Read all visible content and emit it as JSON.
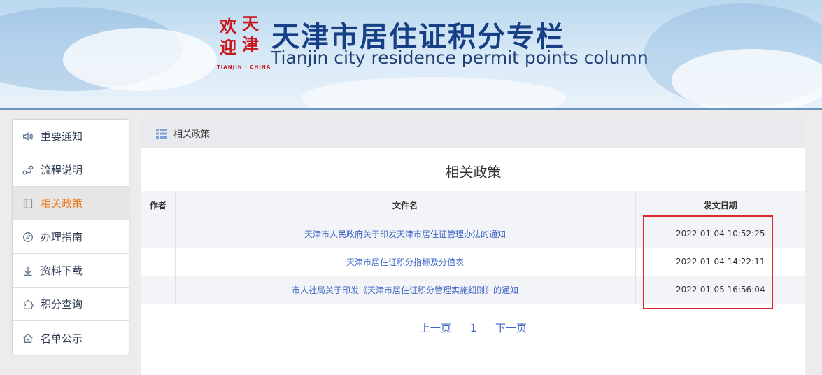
{
  "banner": {
    "seal_text": [
      "天",
      "津",
      "欢",
      "迎"
    ],
    "seal_caption": "TIANJIN · CHINA",
    "title": "天津市居住证积分专栏",
    "subtitle": "Tianjin city residence permit points column"
  },
  "sidebar": {
    "items": [
      {
        "label": "重要通知",
        "icon": "speaker-icon",
        "active": false
      },
      {
        "label": "流程说明",
        "icon": "flow-icon",
        "active": false
      },
      {
        "label": "相关政策",
        "icon": "document-icon",
        "active": true
      },
      {
        "label": "办理指南",
        "icon": "compass-icon",
        "active": false
      },
      {
        "label": "资料下载",
        "icon": "download-icon",
        "active": false
      },
      {
        "label": "积分查询",
        "icon": "puzzle-icon",
        "active": false
      },
      {
        "label": "名单公示",
        "icon": "house-icon",
        "active": false
      }
    ]
  },
  "main": {
    "breadcrumb": "相关政策",
    "section_title": "相关政策",
    "table": {
      "columns": [
        "作者",
        "文件名",
        "发文日期"
      ],
      "rows": [
        {
          "author": "",
          "title": "天津市人民政府关于印发天津市居住证管理办法的通知",
          "date": "2022-01-04 10:52:25"
        },
        {
          "author": "",
          "title": "天津市居住证积分指标及分值表",
          "date": "2022-01-04 14:22:11"
        },
        {
          "author": "",
          "title": "市人社局关于印发《天津市居住证积分管理实施细则》的通知",
          "date": "2022-01-05 16:56:04"
        }
      ]
    },
    "pager": {
      "prev": "上一页",
      "page": "1",
      "next": "下一页"
    }
  },
  "colors": {
    "accent": "#f07a22",
    "link": "#3b64c6",
    "highlight": "#e0262b",
    "title": "#173f86"
  }
}
